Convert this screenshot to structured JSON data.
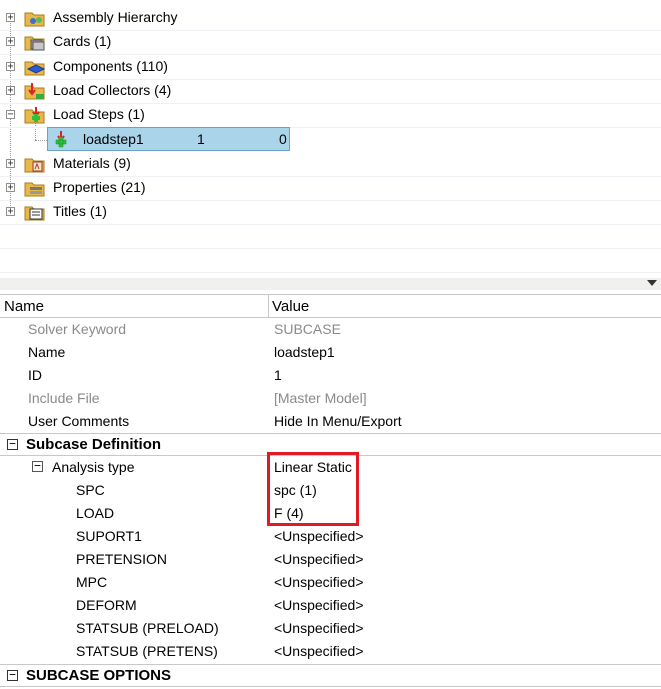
{
  "tree": {
    "items": [
      {
        "label": "Assembly Hierarchy",
        "icon": "assembly-folder-icon",
        "expander": "+"
      },
      {
        "label": "Cards (1)",
        "icon": "cards-folder-icon",
        "expander": "+"
      },
      {
        "label": "Components (110)",
        "icon": "components-folder-icon",
        "expander": "+"
      },
      {
        "label": "Load Collectors (4)",
        "icon": "load-collectors-folder-icon",
        "expander": "+"
      },
      {
        "label": "Load Steps (1)",
        "icon": "load-steps-folder-icon",
        "expander": "−"
      },
      {
        "label": "Materials (9)",
        "icon": "materials-folder-icon",
        "expander": "+"
      },
      {
        "label": "Properties (21)",
        "icon": "properties-folder-icon",
        "expander": "+"
      },
      {
        "label": "Titles (1)",
        "icon": "titles-folder-icon",
        "expander": "+"
      }
    ],
    "selected": {
      "label": "loadstep1",
      "col1": "1",
      "col2": "0",
      "icon": "loadstep-icon"
    }
  },
  "table": {
    "header": {
      "name": "Name",
      "value": "Value"
    },
    "rows": [
      {
        "name": "Solver Keyword",
        "value": "SUBCASE"
      },
      {
        "name": "Name",
        "value": "loadstep1"
      },
      {
        "name": "ID",
        "value": "1"
      },
      {
        "name": "Include File",
        "value": "[Master Model]"
      },
      {
        "name": "User Comments",
        "value": "Hide In Menu/Export"
      }
    ],
    "section1": {
      "title": "Subcase Definition",
      "toggle": "−"
    },
    "analysis": {
      "name": "Analysis type",
      "value": "Linear Static",
      "toggle": "−"
    },
    "subrows": [
      {
        "name": "SPC",
        "value": "spc (1)"
      },
      {
        "name": "LOAD",
        "value": "F (4)"
      },
      {
        "name": "SUPORT1",
        "value": "<Unspecified>"
      },
      {
        "name": "PRETENSION",
        "value": "<Unspecified>"
      },
      {
        "name": "MPC",
        "value": "<Unspecified>"
      },
      {
        "name": "DEFORM",
        "value": "<Unspecified>"
      },
      {
        "name": "STATSUB (PRELOAD)",
        "value": "<Unspecified>"
      },
      {
        "name": "STATSUB (PRETENS)",
        "value": "<Unspecified>"
      }
    ],
    "section2": {
      "title": "SUBCASE OPTIONS",
      "toggle": "−"
    }
  },
  "colors": {
    "selection": "#a9d4ea",
    "highlight": "#e11b24"
  }
}
